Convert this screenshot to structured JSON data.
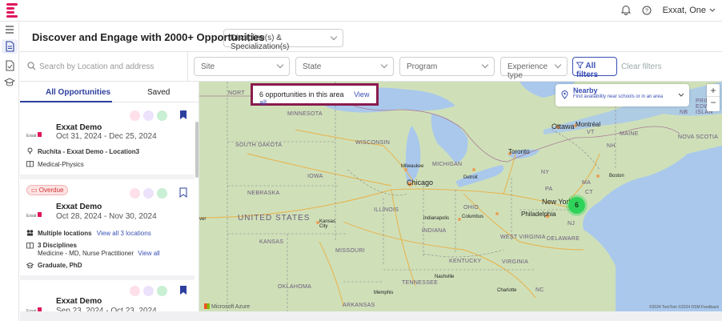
{
  "topbar": {
    "user_label": "Exxat, One",
    "icons": [
      "bell-icon",
      "help-icon",
      "chevron-down-icon"
    ]
  },
  "nav": {
    "icons": [
      "menu-icon",
      "document-icon",
      "file-check-icon",
      "graduation-cap-icon"
    ]
  },
  "header": {
    "title": "Discover and Engage with 2000+ Opportunities",
    "discipline_placeholder": "Discipline(s) & Specialization(s)"
  },
  "filters": {
    "search_placeholder": "Search by Location and address",
    "site": "Site",
    "state": "State",
    "program": "Program",
    "experience": "Experience type",
    "all_filters": "All filters",
    "clear": "Clear filters"
  },
  "tabs": {
    "all": "All Opportunities",
    "saved": "Saved"
  },
  "cards": [
    {
      "logo_text": "Exxat",
      "name": "Exxat Demo",
      "dates": "Oct 31, 2024 - Dec 25, 2024",
      "location": "Ruchita - Exxat Demo - Location3",
      "discipline": "Medical-Physics"
    },
    {
      "overdue": "Overdue",
      "logo_text": "Exxat",
      "name": "Exxat Demo",
      "dates": "Oct 28, 2024 - Nov 30, 2024",
      "location": "Multiple locations",
      "location_link": "View all 3 locations",
      "disciplines_count": "3 Disciplines",
      "disciplines_list": "Medicine - MD, Nurse Practitioner",
      "disciplines_link": "View all",
      "degree": "Graduate, PhD"
    },
    {
      "logo_text": "Exxat",
      "name": "Exxat Demo",
      "dates": "Sep 23, 2024 - Oct 23, 2024"
    }
  ],
  "map": {
    "popup_text": "6 opportunities in this area",
    "popup_link": "View all",
    "nearby_title": "Nearby",
    "nearby_sub": "Find availability near schools or in an area",
    "cluster_count": "6",
    "attribution": "©2024 TomTom ©2024 DSM Feedback",
    "provider": "Microsoft Azure",
    "labels": {
      "north": "NORT",
      "minnesota": "MINNESOTA",
      "south_dakota": "SOUTH DAKOTA",
      "wisconsin": "WISCONSIN",
      "iowa": "IOWA",
      "nebraska": "NEBRASKA",
      "united_states": "UNITED STATES",
      "kansas": "KANSAS",
      "missouri": "MISSOURI",
      "illinois": "ILLINOIS",
      "indiana": "INDIANA",
      "ohio": "OHIO",
      "michigan": "MICHIGAN",
      "kentucky": "KENTUCKY",
      "tennessee": "TENNESSEE",
      "oklahoma": "OKLAHOMA",
      "arkansas": "ARKANSAS",
      "virginia": "VIRGINIA",
      "west_virginia": "WEST VIRGINIA",
      "delaware": "DELAWARE",
      "maine": "MAINE",
      "nova_scotia": "NOVA SCOTIA",
      "chicago": "Chicago",
      "milwaukee": "Milwaukee",
      "detroit": "Detroit",
      "toronto": "Toronto",
      "ottawa": "Ottawa",
      "montreal": "Montréal",
      "boston": "Boston",
      "new_york": "New York",
      "philadelphia": "Philadelphia",
      "columbus": "Columbus",
      "indianapolis": "Indianapolis",
      "kansas_city": "Kansas City",
      "nashville": "Nashville",
      "memphis": "Memphis",
      "charlotte": "Charlotte",
      "denver": "ver",
      "pa": "PA",
      "ny": "NY",
      "vt": "VT",
      "nh": "NH",
      "ma": "MA",
      "ct": "CT",
      "nc": "NC",
      "nj": "NJ",
      "prince_edward": "PRINC EDWAR ISLAN",
      "nb": "NB"
    }
  },
  "colors": {
    "brand": "#e0165f",
    "accent": "#3a4fb3",
    "popup_border": "#8a1b4e",
    "cluster": "#2fd35a",
    "water": "#a9c8ec",
    "land": "#cfe0b9"
  }
}
